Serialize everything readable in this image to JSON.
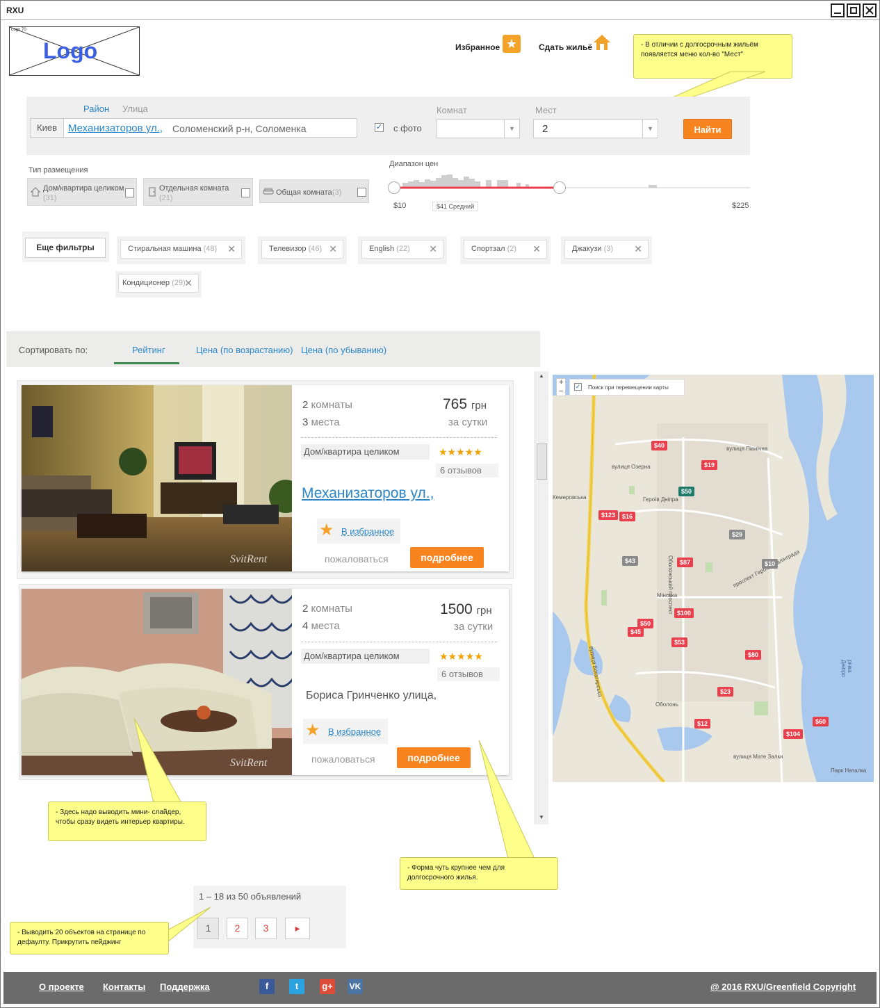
{
  "window": {
    "title": "RXU"
  },
  "logo": {
    "text": "Logo",
    "small": "Logo 70"
  },
  "header": {
    "favorites": "Избранное",
    "rent_out": "Сдать жильё"
  },
  "notes": {
    "places": "- В отличии с долгосрочным жильём появляется меню кол-во \"Мест\"",
    "slider": "- Здесь надо выводить мини- слайдер, чтобы сразу видеть интерьер квартиры.",
    "form": "- Форма чуть крупнее чем для долгосрочного жилья.",
    "paging": "- Выводить 20 объектов на странице по дефаулту. Прикрутить пейджинг"
  },
  "search": {
    "tab_district": "Район",
    "tab_street": "Улица",
    "city": "Киев",
    "street_value": "Механизаторов ул.,",
    "district_hint": "Соломенский р-н, Соломенка",
    "photo_label": "с фото",
    "rooms_label": "Комнат",
    "rooms_value": "",
    "places_label": "Мест",
    "places_value": "2",
    "find_button": "Найти"
  },
  "placement": {
    "label": "Тип размещения",
    "types": [
      {
        "label": "Дом/квартира целиком",
        "count": "(31)"
      },
      {
        "label": "Отдельная комната",
        "count": "(21)"
      },
      {
        "label": "Общая комната",
        "count": "(3)"
      }
    ]
  },
  "price_range": {
    "label": "Диапазон цен",
    "min": "$10",
    "avg": "$41 Средний",
    "max": "$225"
  },
  "filters": {
    "more_button": "Еще фильтры",
    "chips": [
      {
        "label": "Стиральная машина",
        "count": "(48)"
      },
      {
        "label": "Телевизор",
        "count": "(46)"
      },
      {
        "label": "English",
        "count": "(22)"
      },
      {
        "label": "Спортзал",
        "count": "(2)"
      },
      {
        "label": "Джакузи",
        "count": "(3)"
      },
      {
        "label": "Кондиционер",
        "count": "(29)"
      }
    ]
  },
  "sort": {
    "label": "Сортировать по:",
    "tabs": [
      "Рейтинг",
      "Цена (по возрастанию)",
      "Цена (по убыванию)"
    ],
    "active": "Рейтинг"
  },
  "listings": [
    {
      "rooms_num": "2",
      "rooms_word": "комнаты",
      "places_num": "3",
      "places_word": "места",
      "price": "765",
      "currency": "грн",
      "per": "за сутки",
      "type": "Дом/квартира целиком",
      "stars": "★★★★★",
      "reviews": "6 отзывов",
      "address": "Механизаторов ул.,",
      "fav": "В избранное",
      "complain": "пожаловаться",
      "more": "подробнее",
      "watermark": "SvitRent"
    },
    {
      "rooms_num": "2",
      "rooms_word": "комнаты",
      "places_num": "4",
      "places_word": "места",
      "price": "1500",
      "currency": "грн",
      "per": "за сутки",
      "type": "Дом/квартира целиком",
      "stars": "★★★★★",
      "reviews": "6 отзывов",
      "address": "Бориса Гринченко улица,",
      "fav": "В избранное",
      "complain": "пожаловаться",
      "more": "подробнее",
      "watermark": "SvitRent"
    }
  ],
  "map": {
    "search_on_move": "Поиск при перемещении карты",
    "zoom_in": "+",
    "zoom_out": "−",
    "streets": [
      "вулиця Північна",
      "вулиця Озерна",
      "Кемеровська",
      "Героїв Дніпра",
      "Оболонський проспект",
      "Мінська",
      "вулиця Богатирська",
      "Оболонь",
      "проспект Героїв Сталінграда",
      "вулиця Мате Залки",
      "Парк Наталка",
      "річка Дніпро"
    ],
    "markers": [
      {
        "label": "$40",
        "color": "#e8404c"
      },
      {
        "label": "$19",
        "color": "#e8404c"
      },
      {
        "label": "$50",
        "color": "#1f7a6a"
      },
      {
        "label": "$123",
        "color": "#e8404c"
      },
      {
        "label": "$16",
        "color": "#e8404c"
      },
      {
        "label": "$29",
        "color": "#8a8a8a"
      },
      {
        "label": "$43",
        "color": "#8a8a8a"
      },
      {
        "label": "$87",
        "color": "#e8404c"
      },
      {
        "label": "$10",
        "color": "#8a8a8a"
      },
      {
        "label": "$100",
        "color": "#e8404c"
      },
      {
        "label": "$50",
        "color": "#e8404c"
      },
      {
        "label": "$45",
        "color": "#e8404c"
      },
      {
        "label": "$53",
        "color": "#e8404c"
      },
      {
        "label": "$80",
        "color": "#e8404c"
      },
      {
        "label": "$23",
        "color": "#e8404c"
      },
      {
        "label": "$12",
        "color": "#e8404c"
      },
      {
        "label": "$60",
        "color": "#e8404c"
      },
      {
        "label": "$104",
        "color": "#e8404c"
      }
    ]
  },
  "pagination": {
    "summary": "1 – 18 из 50 объявлений",
    "pages": [
      "1",
      "2",
      "3"
    ],
    "next": "▸"
  },
  "footer": {
    "links": [
      "О проекте",
      "Контакты",
      "Поддержка"
    ],
    "social": [
      {
        "name": "facebook-icon",
        "glyph": "f",
        "color": "#3b5998"
      },
      {
        "name": "twitter-icon",
        "glyph": "t",
        "color": "#2aa3e0"
      },
      {
        "name": "google-plus-icon",
        "glyph": "g+",
        "color": "#dd4b39"
      },
      {
        "name": "vk-icon",
        "glyph": "VK",
        "color": "#4c75a3"
      }
    ],
    "copyright": "@ 2016 RXU/Greenfield Copyright"
  }
}
